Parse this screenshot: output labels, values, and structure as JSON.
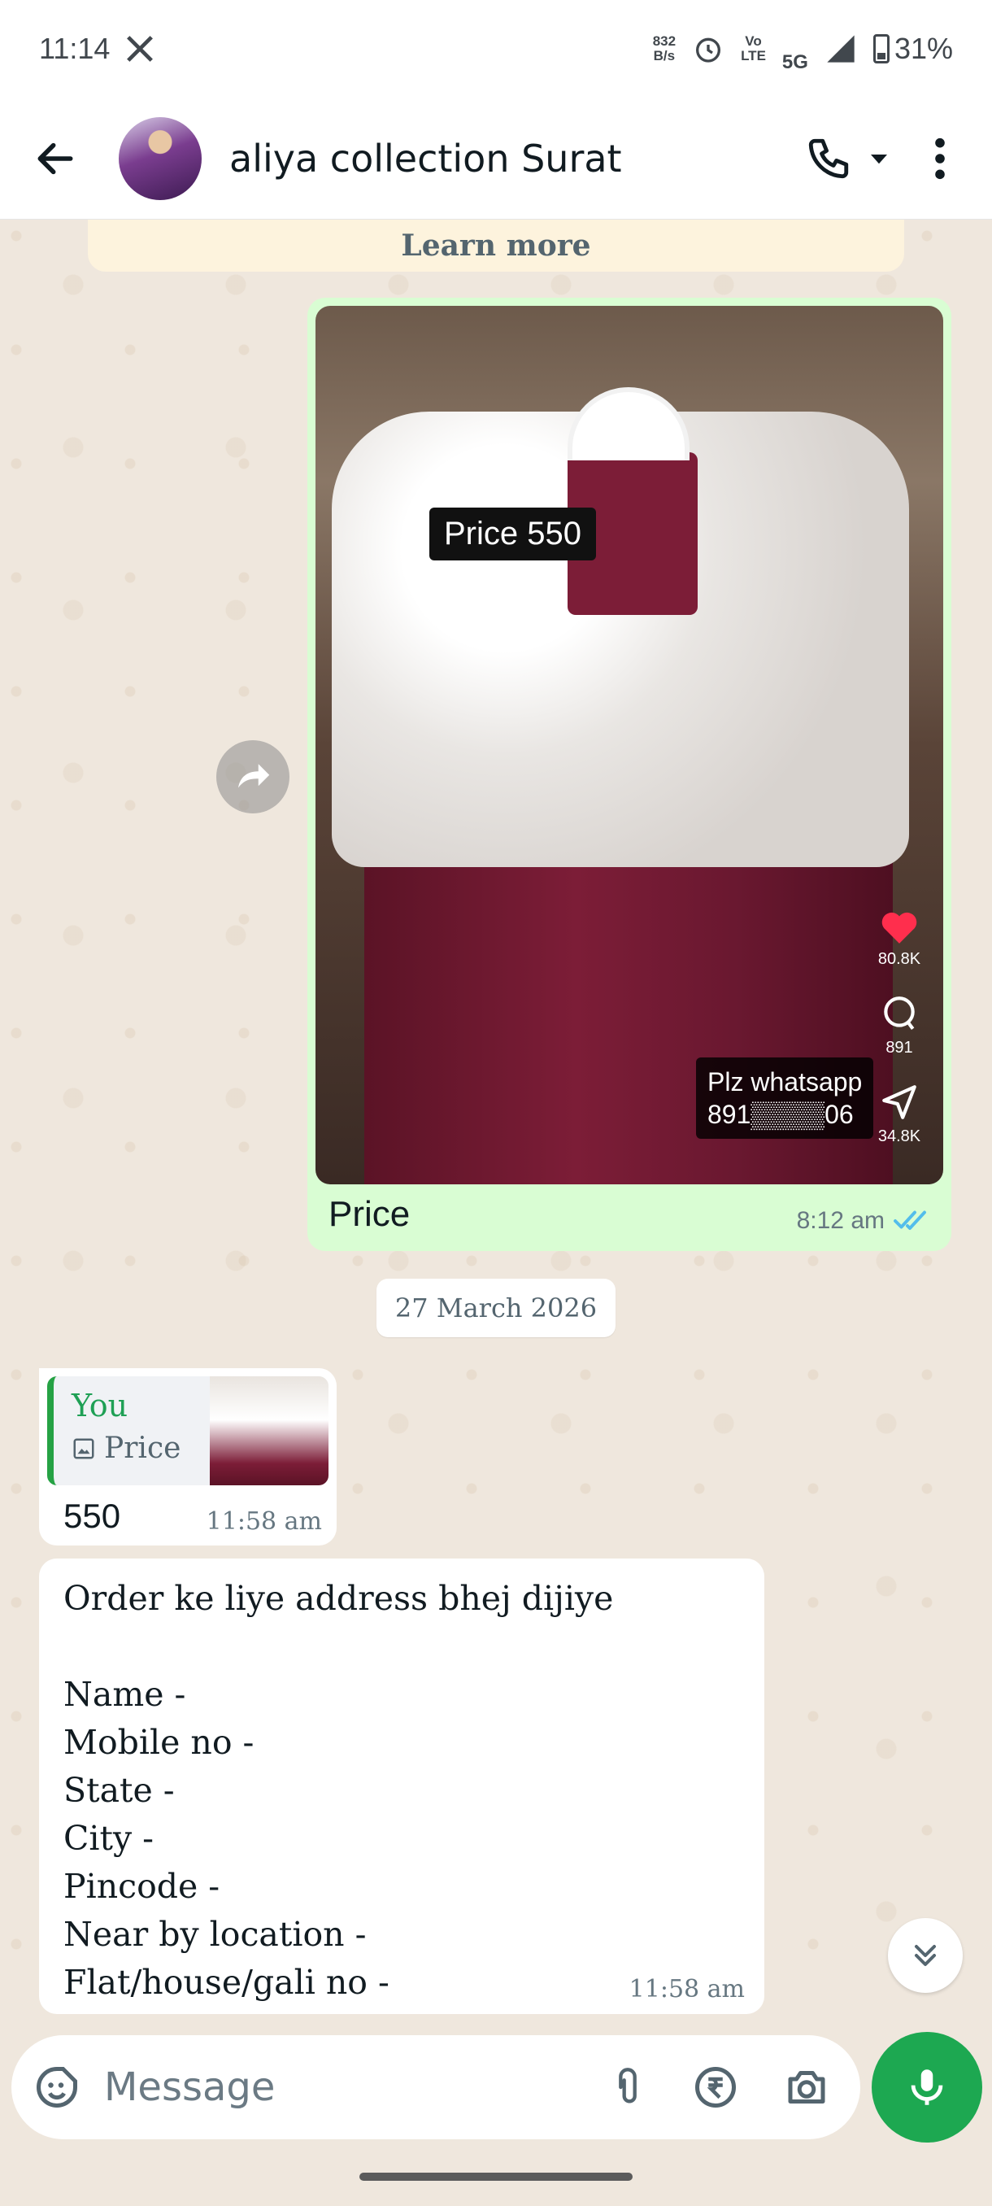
{
  "status_bar": {
    "time": "11:14",
    "net_speed_value": "832",
    "net_speed_unit": "B/s",
    "volte_top": "Vo",
    "volte_bottom": "LTE",
    "network": "5G",
    "battery": "31%"
  },
  "header": {
    "contact_name": "aliya collection Surat"
  },
  "banner": {
    "learn_more": "Learn more"
  },
  "messages": {
    "media_post": {
      "overlay_price": "Price 550",
      "overlay_contact_line1": "Plz whatsapp",
      "overlay_contact_line2": "891▒▒▒▒06",
      "likes": "80.8K",
      "comments": "891",
      "shares": "34.8K",
      "caption": "Price",
      "time": "8:12 am",
      "status": "read"
    },
    "date_separator": "27 March 2026",
    "reply": {
      "quoted_author": "You",
      "quoted_type": "Price",
      "text": "550",
      "time": "11:58 am"
    },
    "address_request": {
      "lines": [
        "Order ke liye address bhej dijiye",
        "",
        "Name -",
        "Mobile no -",
        "State -",
        "City -",
        "Pincode -",
        "Near by location -",
        "Flat/house/gali no -"
      ],
      "time": "11:58 am"
    }
  },
  "composer": {
    "placeholder": "Message"
  },
  "colors": {
    "accent_green": "#1da851",
    "outgoing_bubble": "#d9fdd3",
    "read_ticks": "#53bdeb",
    "chat_bg": "#efe7dd"
  }
}
